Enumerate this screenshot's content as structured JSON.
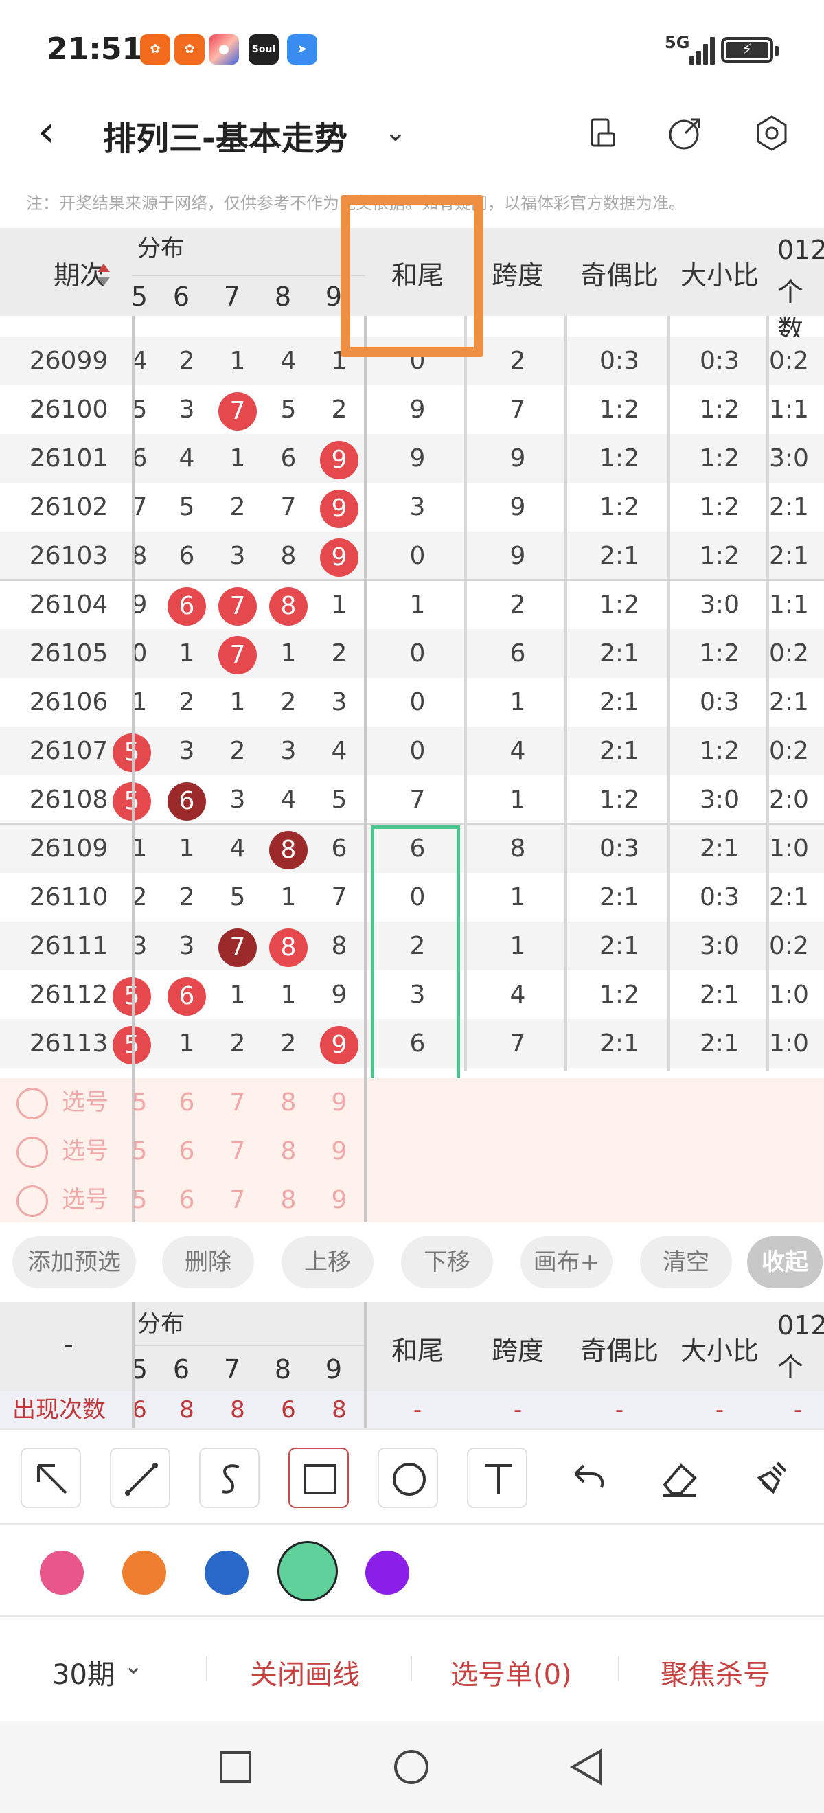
{
  "status_bar": {
    "time": "21:51",
    "app_icons": [
      "kuaishou-icon",
      "kuaishou-icon",
      "game-icon",
      "soul-icon",
      "blue-app-icon"
    ],
    "soul_label": "Soul",
    "network": "5G",
    "battery": "charging"
  },
  "header": {
    "title": "排列三-基本走势",
    "icons": [
      "back-icon",
      "dropdown-chevron-icon",
      "phone-rotate-icon",
      "share-icon",
      "settings-icon"
    ]
  },
  "note": "注：开奖结果来源于网络，仅供参考不作为兑奖依据。如有疑问，以福体彩官方数据为准。",
  "table": {
    "col_period": "期次",
    "col_dist": "分布",
    "dist_digits": [
      "5",
      "6",
      "7",
      "8",
      "9"
    ],
    "col_hewei": "和尾",
    "col_kuadu": "跨度",
    "col_jiou": "奇偶比",
    "col_daxiao": "大小比",
    "col_012_line1": "012",
    "col_012_line2": "个数",
    "rows": [
      {
        "period": "26099",
        "d": [
          "4",
          "2",
          "1",
          "4",
          "1"
        ],
        "hewei": "0",
        "kuadu": "2",
        "jiou": "0:3",
        "daxiao": "0:3",
        "c012": "0:2"
      },
      {
        "period": "26100",
        "d": [
          "5",
          "3",
          "7",
          "5",
          "2"
        ],
        "hewei": "9",
        "kuadu": "7",
        "jiou": "1:2",
        "daxiao": "1:2",
        "c012": "1:1"
      },
      {
        "period": "26101",
        "d": [
          "6",
          "4",
          "1",
          "6",
          "9"
        ],
        "hewei": "9",
        "kuadu": "9",
        "jiou": "1:2",
        "daxiao": "1:2",
        "c012": "3:0"
      },
      {
        "period": "26102",
        "d": [
          "7",
          "5",
          "2",
          "7",
          "9"
        ],
        "hewei": "3",
        "kuadu": "9",
        "jiou": "1:2",
        "daxiao": "1:2",
        "c012": "2:1"
      },
      {
        "period": "26103",
        "d": [
          "8",
          "6",
          "3",
          "8",
          "9"
        ],
        "hewei": "0",
        "kuadu": "9",
        "jiou": "2:1",
        "daxiao": "1:2",
        "c012": "2:1"
      },
      {
        "period": "26104",
        "d": [
          "9",
          "6",
          "7",
          "8",
          "1"
        ],
        "hewei": "1",
        "kuadu": "2",
        "jiou": "1:2",
        "daxiao": "3:0",
        "c012": "1:1"
      },
      {
        "period": "26105",
        "d": [
          "0",
          "1",
          "7",
          "1",
          "2"
        ],
        "hewei": "0",
        "kuadu": "6",
        "jiou": "2:1",
        "daxiao": "1:2",
        "c012": "0:2"
      },
      {
        "period": "26106",
        "d": [
          "1",
          "2",
          "1",
          "2",
          "3"
        ],
        "hewei": "0",
        "kuadu": "1",
        "jiou": "2:1",
        "daxiao": "0:3",
        "c012": "2:1"
      },
      {
        "period": "26107",
        "d": [
          "5",
          "3",
          "2",
          "3",
          "4"
        ],
        "hewei": "0",
        "kuadu": "4",
        "jiou": "2:1",
        "daxiao": "1:2",
        "c012": "0:2"
      },
      {
        "period": "26108",
        "d": [
          "5",
          "6",
          "3",
          "4",
          "5"
        ],
        "hewei": "7",
        "kuadu": "1",
        "jiou": "1:2",
        "daxiao": "3:0",
        "c012": "2:0"
      },
      {
        "period": "26109",
        "d": [
          "1",
          "1",
          "4",
          "8",
          "6"
        ],
        "hewei": "6",
        "kuadu": "8",
        "jiou": "0:3",
        "daxiao": "2:1",
        "c012": "1:0"
      },
      {
        "period": "26110",
        "d": [
          "2",
          "2",
          "5",
          "1",
          "7"
        ],
        "hewei": "0",
        "kuadu": "1",
        "jiou": "2:1",
        "daxiao": "0:3",
        "c012": "2:1"
      },
      {
        "period": "26111",
        "d": [
          "3",
          "3",
          "7",
          "8",
          "8"
        ],
        "hewei": "2",
        "kuadu": "1",
        "jiou": "2:1",
        "daxiao": "3:0",
        "c012": "0:2"
      },
      {
        "period": "26112",
        "d": [
          "5",
          "6",
          "1",
          "1",
          "9"
        ],
        "hewei": "3",
        "kuadu": "4",
        "jiou": "1:2",
        "daxiao": "2:1",
        "c012": "1:0"
      },
      {
        "period": "26113",
        "d": [
          "5",
          "1",
          "2",
          "2",
          "9"
        ],
        "hewei": "6",
        "kuadu": "7",
        "jiou": "2:1",
        "daxiao": "2:1",
        "c012": "1:0"
      }
    ]
  },
  "pick_rows": {
    "label": "选号",
    "digits": [
      "5",
      "6",
      "7",
      "8",
      "9"
    ]
  },
  "action_buttons": [
    "添加预选",
    "删除",
    "上移",
    "下移",
    "画布+",
    "清空",
    "收起"
  ],
  "stats": {
    "dash": "-",
    "dist": "分布",
    "digits": [
      "5",
      "6",
      "7",
      "8",
      "9"
    ],
    "hewei": "和尾",
    "kuadu": "跨度",
    "jiou": "奇偶比",
    "daxiao": "大小比",
    "c012_line1": "012",
    "c012_line2": "个数",
    "label": "出现次数",
    "values": [
      "6",
      "8",
      "8",
      "6",
      "8"
    ],
    "rest": [
      "-",
      "-",
      "-",
      "-",
      "-"
    ]
  },
  "drawing_tools": [
    "arrow-tool-icon",
    "line-tool-icon",
    "freehand-tool-icon",
    "rectangle-tool-icon",
    "circle-tool-icon",
    "text-tool-icon",
    "undo-icon",
    "eraser-icon",
    "brush-clear-icon"
  ],
  "colors": {
    "pink": "#e8568a",
    "orange": "#ef7f2e",
    "blue": "#2a68c8",
    "green": "#5dd199",
    "purple": "#8b1fe8",
    "accent_red": "#c94242",
    "annotation_orange": "#ee8e43",
    "annotation_green": "#4cc48c"
  },
  "bottom_bar": {
    "period": "30期",
    "close_lines": "关闭画线",
    "pick_list": "选号单(0)",
    "focus_kill": "聚焦杀号"
  }
}
